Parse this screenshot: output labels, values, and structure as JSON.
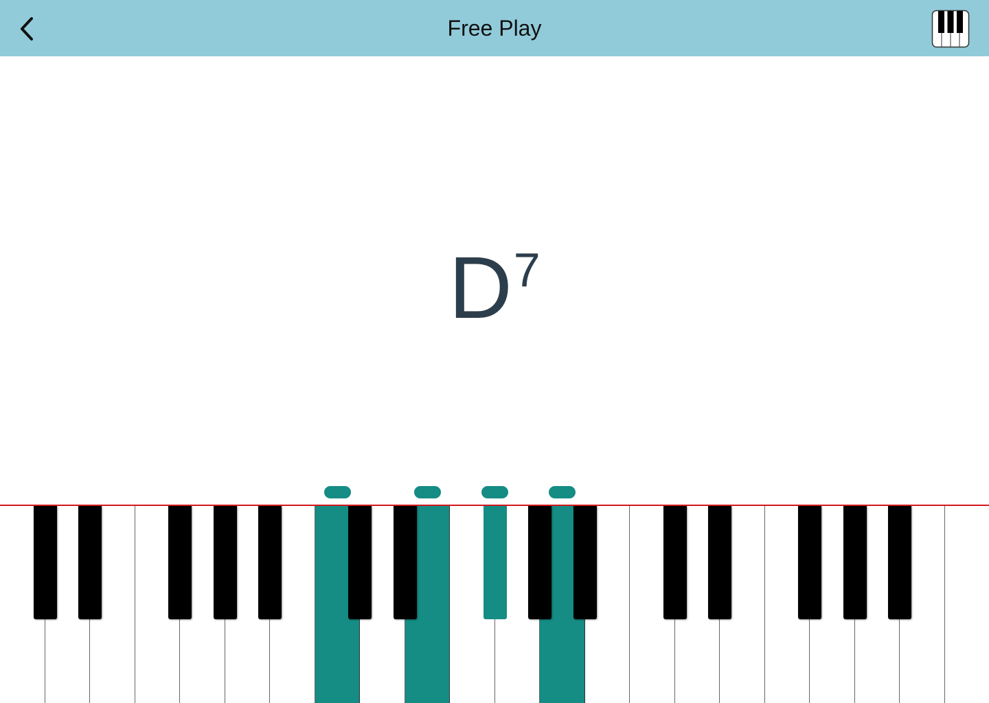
{
  "header": {
    "title": "Free Play",
    "back_icon": "chevron-left-icon",
    "keyboard_icon": "piano-keys-icon",
    "background": "#91cbd9"
  },
  "chord": {
    "root": "D",
    "quality": "7",
    "color": "#2c3e4c"
  },
  "piano": {
    "accent_color": "#158c84",
    "indicator_line_color": "#d4171b",
    "white_key_count": 22,
    "active_white_keys": [
      7,
      9,
      12
    ],
    "black_keys": [
      {
        "after_white": 0,
        "active": false
      },
      {
        "after_white": 1,
        "active": false
      },
      {
        "after_white": 3,
        "active": false
      },
      {
        "after_white": 4,
        "active": false
      },
      {
        "after_white": 5,
        "active": false
      },
      {
        "after_white": 7,
        "active": false
      },
      {
        "after_white": 8,
        "active": false
      },
      {
        "after_white": 10,
        "active": true
      },
      {
        "after_white": 11,
        "active": false
      },
      {
        "after_white": 12,
        "active": false
      },
      {
        "after_white": 14,
        "active": false
      },
      {
        "after_white": 15,
        "active": false
      },
      {
        "after_white": 17,
        "active": false
      },
      {
        "after_white": 18,
        "active": false
      },
      {
        "after_white": 19,
        "active": false
      }
    ]
  }
}
